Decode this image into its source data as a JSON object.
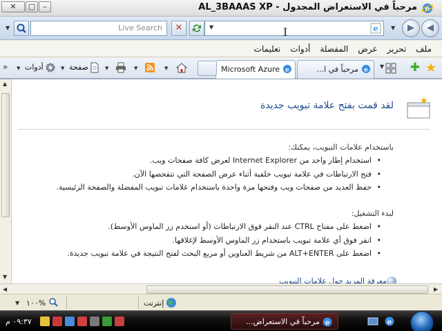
{
  "window": {
    "title": "مرحباً في الاستعراض المجدول - AL_3BAAAS XP",
    "minimize_label": "0",
    "maximize_label": "1",
    "close_label": "r"
  },
  "address_bar": {
    "url": "",
    "search_placeholder": "Live Search"
  },
  "menu": {
    "items": [
      "ملف",
      "تحرير",
      "عرض",
      "المفضلة",
      "أدوات",
      "تعليمات"
    ]
  },
  "tabs": [
    {
      "label": "مرحباً في ا...",
      "active": true
    },
    {
      "label": "Microsoft Azure",
      "active": false
    }
  ],
  "commands": {
    "tools_label": "أدوات",
    "page_label": "صفحة"
  },
  "page": {
    "title": "لقد قمت بفتح علامة تبويب جديدة",
    "section1_heading": "باستخدام علامات التبويب، يمكنك:",
    "section1_items": [
      "استخدام إطار واحد من Internet Explorer لعرض كافة صفحات ويب.",
      "فتح الارتباطات في علامة تبويب خلفية أثناء عرض الصفحة التي تتفحصها الآن.",
      "حفظ العديد من صفحات ويب وفتحها مرة واحدة باستخدام علامات تبويب المفضلة والصفحة الرئيسية."
    ],
    "section2_heading": "لبدء التشغيل:",
    "section2_items": [
      "اضغط على مفتاح CTRL عند النقر فوق الارتباطات (أو استخدم زر الماوس الأوسط).",
      "انقر فوق أي علامة تبويب باستخدام زر الماوس الأوسط لإغلاقها.",
      "اضغط على ALT+ENTER من شريط العناوين أو مربع البحث لفتح النتيجة في علامة تبويب جديدة."
    ],
    "more_link": "معرفة المزيد حول علامات التبويب"
  },
  "status": {
    "zoom": "١٠٠%",
    "zone": "إنترنت"
  },
  "taskbar": {
    "task_label": "مرحباً في الاستعراض...",
    "clock": "٠٩:٣٧ م"
  },
  "colors": {
    "accent": "#1e4a8c",
    "taskbar": "#111111",
    "task_button": "#5a2020"
  }
}
